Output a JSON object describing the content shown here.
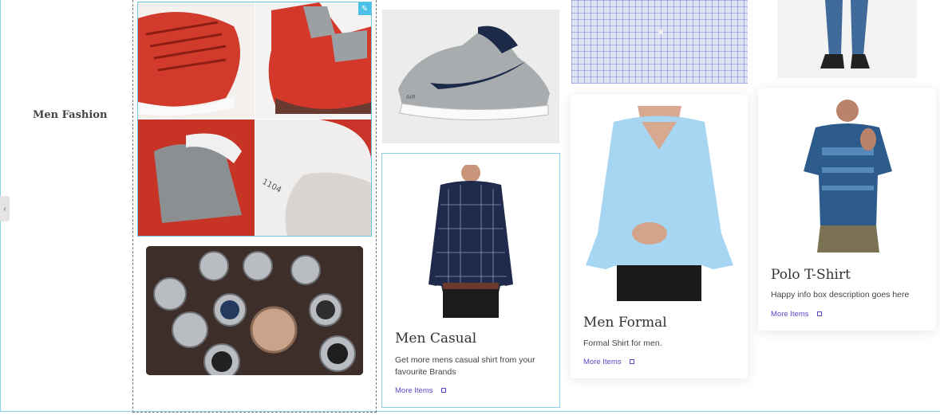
{
  "section": {
    "title": "Men Fashion"
  },
  "collapse_toggle": {
    "glyph": "‹"
  },
  "images": {
    "sneaker_collage": {
      "icon": "sneaker-collage-image"
    },
    "watches": {
      "icon": "watch-box-image"
    },
    "nike_sneaker": {
      "icon": "grey-sneaker-image",
      "brand_text": "AIR"
    },
    "shirt_pattern": {
      "icon": "checked-shirt-image"
    },
    "jeans": {
      "icon": "jeans-boots-image"
    },
    "stamp_text": "1104"
  },
  "cards": {
    "casual": {
      "title": "Men Casual",
      "description": "Get more mens casual shirt from your favourite Brands",
      "link": "More Items"
    },
    "formal": {
      "title": "Men Formal",
      "description": "Formal Shirt for men.",
      "link": "More Items"
    },
    "polo": {
      "title": "Polo T-Shirt",
      "description": "Happy info box description goes here",
      "link": "More Items"
    }
  },
  "colors": {
    "accent_border": "#8fd3ea",
    "link": "#5a47c8",
    "edit_badge": "#4ac0e8"
  }
}
